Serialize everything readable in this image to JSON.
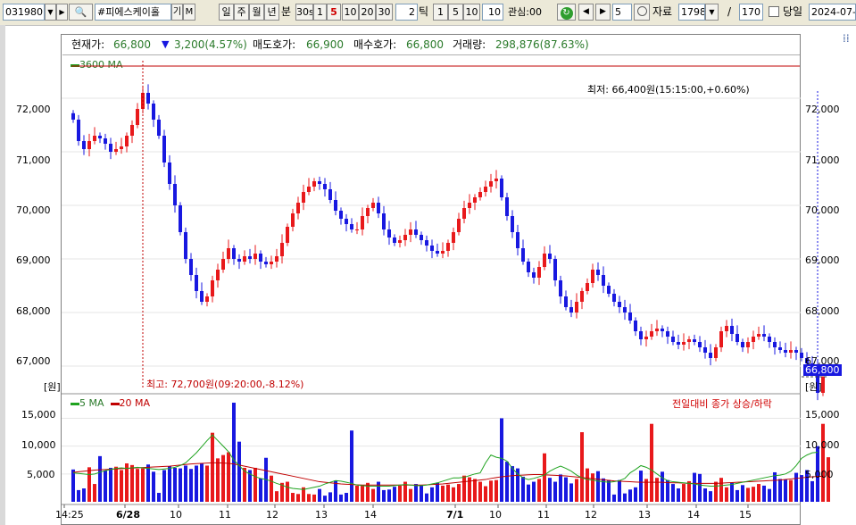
{
  "toolbar": {
    "code": "031980",
    "name": "#피에스케이홀",
    "period_buttons": [
      "일",
      "주",
      "월",
      "년",
      "분"
    ],
    "interval_buttons": [
      "30s",
      "1",
      "5",
      "10",
      "20",
      "30"
    ],
    "selected_interval": "5",
    "tick_value": "2",
    "tick_label": "틱",
    "tick_buttons": [
      "1",
      "5",
      "10"
    ],
    "count_value": "10",
    "interest_label": "관심:00",
    "step_value": "5",
    "data_label": "자료",
    "data_count": "1798",
    "page_sep": "/",
    "page_total": "170",
    "today_label": "당일",
    "date_value": "2024-07-"
  },
  "info_bar": {
    "price_label": "현재가:",
    "price_value": "66,800",
    "change_value": "3,200(4.57%)",
    "ask_label": "매도호가:",
    "ask_value": "66,900",
    "bid_label": "매수호가:",
    "bid_value": "66,800",
    "volume_label": "거래량:",
    "volume_value": "298,876(87.63%)"
  },
  "colors": {
    "up": "#e8191b",
    "down": "#1818e0",
    "ma_short": "#1fa31f",
    "ma_long": "#c00000",
    "label_green": "#2a7a2a"
  },
  "chart_data": [
    {
      "type": "candlestick",
      "legend": [
        "3600 MA"
      ],
      "y_ticks": [
        "72,000",
        "71,000",
        "70,000",
        "69,000",
        "68,000",
        "67,000"
      ],
      "ylim": [
        66500,
        72800
      ],
      "unit_label": "[원]",
      "current_price_label": "66,800",
      "max_annotation": "최고: 72,700원(09:20:00,-8.12%)",
      "min_annotation": "최저: 66,400원(15:15:00,+0.60%)",
      "reference_line": 72600,
      "x_labels": [
        "14:25",
        "6/28",
        "10",
        "11",
        "12",
        "13",
        "14",
        "7/1",
        "10",
        "11",
        "12",
        "13",
        "14",
        "15"
      ],
      "bold_x_labels": [
        "6/28",
        "7/1"
      ],
      "closes": [
        71600,
        71200,
        71050,
        71200,
        71300,
        71250,
        71150,
        71000,
        71050,
        71100,
        71300,
        71500,
        71800,
        72100,
        71900,
        71600,
        71300,
        70800,
        70400,
        70000,
        69500,
        69000,
        68700,
        68400,
        68200,
        68300,
        68600,
        68800,
        69000,
        69200,
        69000,
        68950,
        69050,
        69000,
        69100,
        68950,
        68900,
        68950,
        69050,
        69300,
        69600,
        69850,
        70050,
        70250,
        70350,
        70450,
        70400,
        70300,
        70100,
        69900,
        69750,
        69650,
        69550,
        69550,
        69800,
        69950,
        70050,
        69850,
        69550,
        69400,
        69300,
        69350,
        69450,
        69550,
        69450,
        69350,
        69250,
        69150,
        69100,
        69150,
        69300,
        69500,
        69750,
        69950,
        70050,
        70150,
        70250,
        70350,
        70450,
        70500,
        70150,
        69800,
        69500,
        69200,
        68950,
        68750,
        68650,
        68850,
        69100,
        69000,
        68600,
        68300,
        68100,
        68000,
        68200,
        68400,
        68550,
        68800,
        68700,
        68500,
        68350,
        68200,
        68100,
        68000,
        67850,
        67650,
        67500,
        67550,
        67650,
        67700,
        67650,
        67550,
        67450,
        67400,
        67450,
        67500,
        67450,
        67350,
        67250,
        67150,
        67350,
        67650,
        67750,
        67600,
        67450,
        67350,
        67450,
        67550,
        67600,
        67550,
        67450,
        67350,
        67300,
        67250,
        67300,
        67250,
        67150,
        67050,
        66950,
        66500,
        66800
      ]
    },
    {
      "type": "bar",
      "legend": [
        "5 MA",
        "20 MA"
      ],
      "legend_right": "전일대비 종가 상승/하락",
      "y_ticks": [
        "15,000",
        "10,000",
        "5,000"
      ],
      "ylim": [
        0,
        17000
      ],
      "volumes": [
        5800,
        2100,
        2400,
        6200,
        3200,
        8200,
        5600,
        6100,
        6300,
        5700,
        6900,
        6600,
        5900,
        6000,
        6700,
        5400,
        1600,
        5700,
        6400,
        6100,
        6000,
        6500,
        5900,
        6500,
        6900,
        6500,
        12400,
        7800,
        8400,
        8900,
        17800,
        10800,
        6100,
        5700,
        6100,
        4200,
        7900,
        4700,
        1900,
        3400,
        3600,
        1600,
        1400,
        2600,
        1400,
        1300,
        2300,
        1100,
        1700,
        3800,
        1300,
        1600,
        12800,
        2900,
        3000,
        3400,
        2300,
        3600,
        2100,
        2200,
        2700,
        2900,
        3600,
        2300,
        3200,
        2900,
        1500,
        2600,
        3400,
        2900,
        3100,
        2600,
        3200,
        4700,
        4400,
        4100,
        3600,
        2800,
        3800,
        3900,
        15000,
        7200,
        6400,
        6000,
        4500,
        3100,
        3600,
        4100,
        8700,
        4300,
        3600,
        4900,
        4400,
        3300,
        4100,
        12500,
        6000,
        5100,
        5500,
        4200,
        3900,
        1300,
        3900,
        1500,
        2200,
        2600,
        5600,
        4100,
        14000,
        4300,
        5400,
        3900,
        3200,
        2400,
        3200,
        3700,
        5200,
        5000,
        2400,
        1900,
        3600,
        4300,
        2600,
        3400,
        2100,
        3000,
        2500,
        2700,
        3200,
        2900,
        2300,
        5300,
        4100,
        4000,
        3900,
        5200,
        4800,
        5700,
        3700,
        10000,
        14000,
        8000
      ],
      "ma5": [
        5200,
        5100,
        5000,
        4900,
        5000,
        5300,
        5600,
        5800,
        6000,
        6100,
        6000,
        6100,
        6200,
        6100,
        6000,
        5900,
        5800,
        5900,
        6000,
        6200,
        6500,
        7000,
        7900,
        8800,
        9900,
        11000,
        12000,
        11000,
        10000,
        9000,
        7500,
        6500,
        5500,
        5000,
        4500,
        4200,
        4000,
        3700,
        3300,
        3000,
        2600,
        2400,
        2300,
        2200,
        2400,
        2600,
        2800,
        3200,
        3500,
        3800,
        3700,
        3500,
        3300,
        3000,
        2900,
        2800,
        2800,
        2800,
        2800,
        2800,
        2900,
        3000,
        3100,
        3000,
        2900,
        2900,
        3000,
        3200,
        3400,
        3700,
        4000,
        4300,
        4300,
        4400,
        4700,
        5000,
        5200,
        7000,
        8400,
        8000,
        7800,
        7300,
        6000,
        5000,
        4300,
        4000,
        4200,
        4500,
        4800,
        5500,
        6000,
        6400,
        6000,
        5500,
        4800,
        4300,
        4000,
        3900,
        3700,
        3600,
        3500,
        3600,
        3800,
        4200,
        5200,
        5800,
        6500,
        6200,
        5700,
        5000,
        4300,
        3800,
        3600,
        3500,
        3400,
        3300,
        3200,
        3000,
        2900,
        2800,
        2800,
        2900,
        3000,
        3100,
        3300,
        3500,
        3700,
        3900,
        4100,
        4300,
        4500,
        4700,
        4800,
        5000,
        5500,
        6500,
        7800,
        8400,
        8800,
        8900
      ],
      "ma20": [
        5300,
        5400,
        5500,
        5600,
        5700,
        5750,
        5800,
        5850,
        5900,
        5950,
        6000,
        6050,
        6100,
        6150,
        6200,
        6250,
        6300,
        6350,
        6400,
        6500,
        6600,
        6700,
        6800,
        6850,
        6900,
        6950,
        7000,
        7000,
        6950,
        6900,
        6800,
        6600,
        6400,
        6200,
        6000,
        5800,
        5600,
        5400,
        5200,
        5000,
        4800,
        4600,
        4400,
        4200,
        4000,
        3800,
        3600,
        3500,
        3400,
        3300,
        3200,
        3150,
        3100,
        3050,
        3000,
        3000,
        3000,
        3000,
        3000,
        3000,
        3000,
        3000,
        3000,
        3000,
        3000,
        3000,
        3050,
        3100,
        3150,
        3200,
        3300,
        3400,
        3500,
        3600,
        3700,
        3800,
        3900,
        4000,
        4200,
        4350,
        4500,
        4600,
        4700,
        4750,
        4800,
        4850,
        4900,
        4900,
        4850,
        4800,
        4750,
        4700,
        4650,
        4550,
        4450,
        4350,
        4250,
        4150,
        4050,
        3950,
        3850,
        3750,
        3700,
        3650,
        3600,
        3550,
        3500,
        3500,
        3500,
        3500,
        3500,
        3450,
        3400,
        3400,
        3350,
        3300,
        3300,
        3300,
        3300,
        3300,
        3300,
        3350,
        3400,
        3450,
        3500,
        3550,
        3600,
        3650,
        3700,
        3750,
        3800,
        3850,
        3900,
        4000,
        4100,
        4200,
        4300,
        4400,
        4500,
        4550,
        4600
      ]
    }
  ]
}
